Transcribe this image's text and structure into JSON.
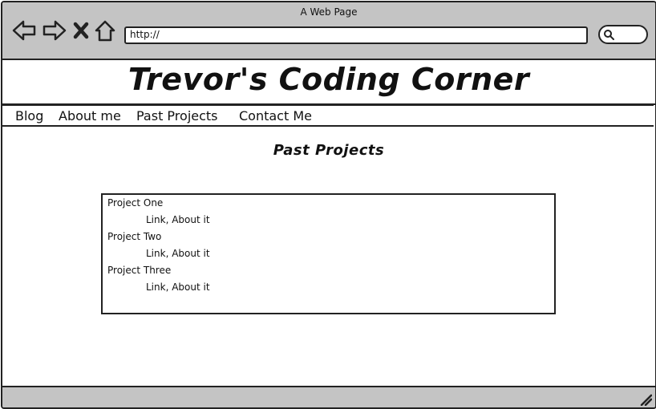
{
  "window": {
    "title": "A Web Page"
  },
  "address_bar": {
    "value": "http://"
  },
  "site": {
    "title": "Trevor's Coding Corner"
  },
  "nav": {
    "items": [
      "Blog",
      "About me",
      "Past Projects",
      "Contact Me"
    ]
  },
  "page": {
    "heading": "Past Projects"
  },
  "projects": [
    {
      "name": "Project One",
      "links": "Link, About it"
    },
    {
      "name": "Project Two",
      "links": "Link, About it"
    },
    {
      "name": "Project Three",
      "links": "Link, About it"
    }
  ],
  "icons": {
    "back": "arrow-left-icon",
    "forward": "arrow-right-icon",
    "stop": "close-icon",
    "home": "home-icon",
    "search": "search-icon",
    "resize": "resize-grip-icon"
  }
}
